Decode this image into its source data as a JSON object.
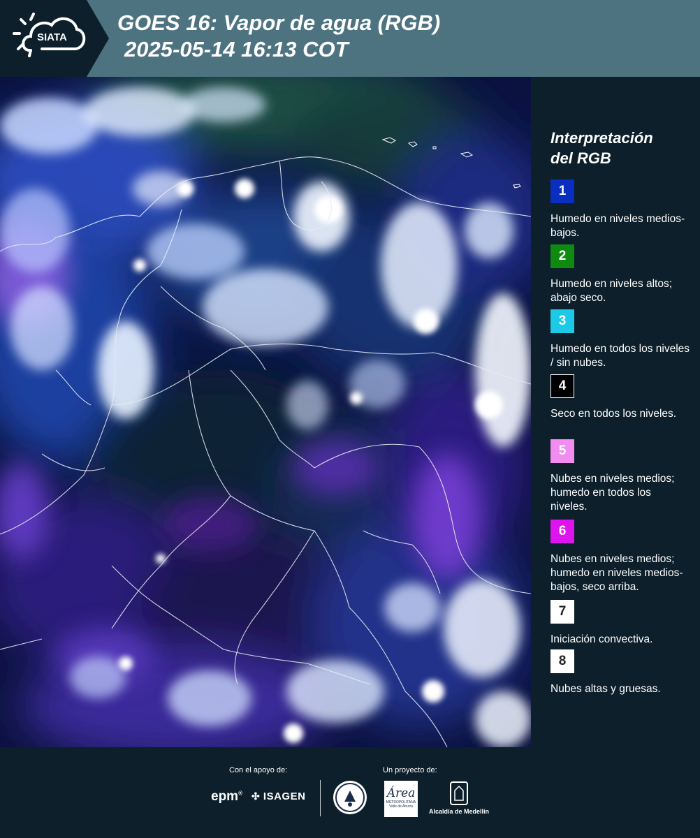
{
  "header": {
    "logo_text": "SIATA",
    "title_line1": "GOES 16: Vapor de agua (RGB)",
    "title_line2": "2025-05-14 16:13 COT"
  },
  "legend": {
    "title_line1": "Interpretación",
    "title_line2": "del RGB",
    "items": [
      {
        "num": "1",
        "color": "#0a2ec0",
        "text": "Humedo en niveles medios-bajos."
      },
      {
        "num": "2",
        "color": "#0f8a10",
        "text": "Humedo en niveles altos; abajo seco."
      },
      {
        "num": "3",
        "color": "#1cc9e6",
        "text": "Humedo en todos los niveles / sin nubes."
      },
      {
        "num": "4",
        "color": "#000000",
        "text": "Seco en todos los niveles."
      },
      {
        "num": "5",
        "color": "#f28cf0",
        "text": "Nubes en niveles medios; humedo en todos los niveles."
      },
      {
        "num": "6",
        "color": "#dd14ee",
        "text": "Nubes en niveles medios; humedo en niveles medios-bajos, seco arriba."
      },
      {
        "num": "7",
        "color": "#ffffff",
        "text": "Iniciación convectiva."
      },
      {
        "num": "8",
        "color": "#ffffff",
        "text": "Nubes altas y gruesas."
      }
    ]
  },
  "footer": {
    "support_label": "Con el apoyo de:",
    "project_label": "Un proyecto de:",
    "epm": "epm",
    "isagen": "ISAGEN",
    "area_script": "Área",
    "area_line1": "METROPOLITANA",
    "area_line2": "Valle de Aburrá",
    "alcaldia": "Alcaldía de Medellín"
  }
}
